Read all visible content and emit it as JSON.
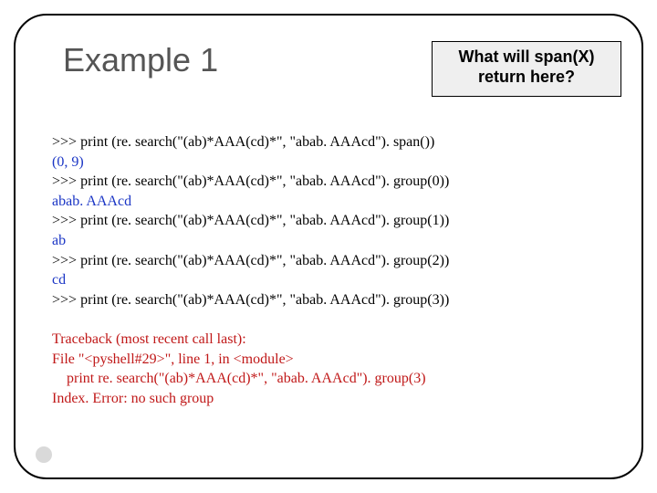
{
  "title": "Example 1",
  "callout": "What will span(X) return here?",
  "code": {
    "l1": ">>> print (re. search(\"(ab)*AAA(cd)*\", \"abab. AAAcd\"). span())",
    "l2": "(0, 9)",
    "l3": ">>> print (re. search(\"(ab)*AAA(cd)*\", \"abab. AAAcd\"). group(0))",
    "l4": "abab. AAAcd",
    "l5": ">>> print (re. search(\"(ab)*AAA(cd)*\", \"abab. AAAcd\"). group(1))",
    "l6": "ab",
    "l7": ">>> print (re. search(\"(ab)*AAA(cd)*\", \"abab. AAAcd\"). group(2))",
    "l8": "cd",
    "l9": ">>> print (re. search(\"(ab)*AAA(cd)*\", \"abab. AAAcd\"). group(3))",
    "l10": "",
    "l11": "Traceback (most recent call last):",
    "l12": "File \"<pyshell#29>\", line 1, in <module>",
    "l13": "    print re. search(\"(ab)*AAA(cd)*\", \"abab. AAAcd\"). group(3)",
    "l14": "Index. Error: no such group"
  }
}
